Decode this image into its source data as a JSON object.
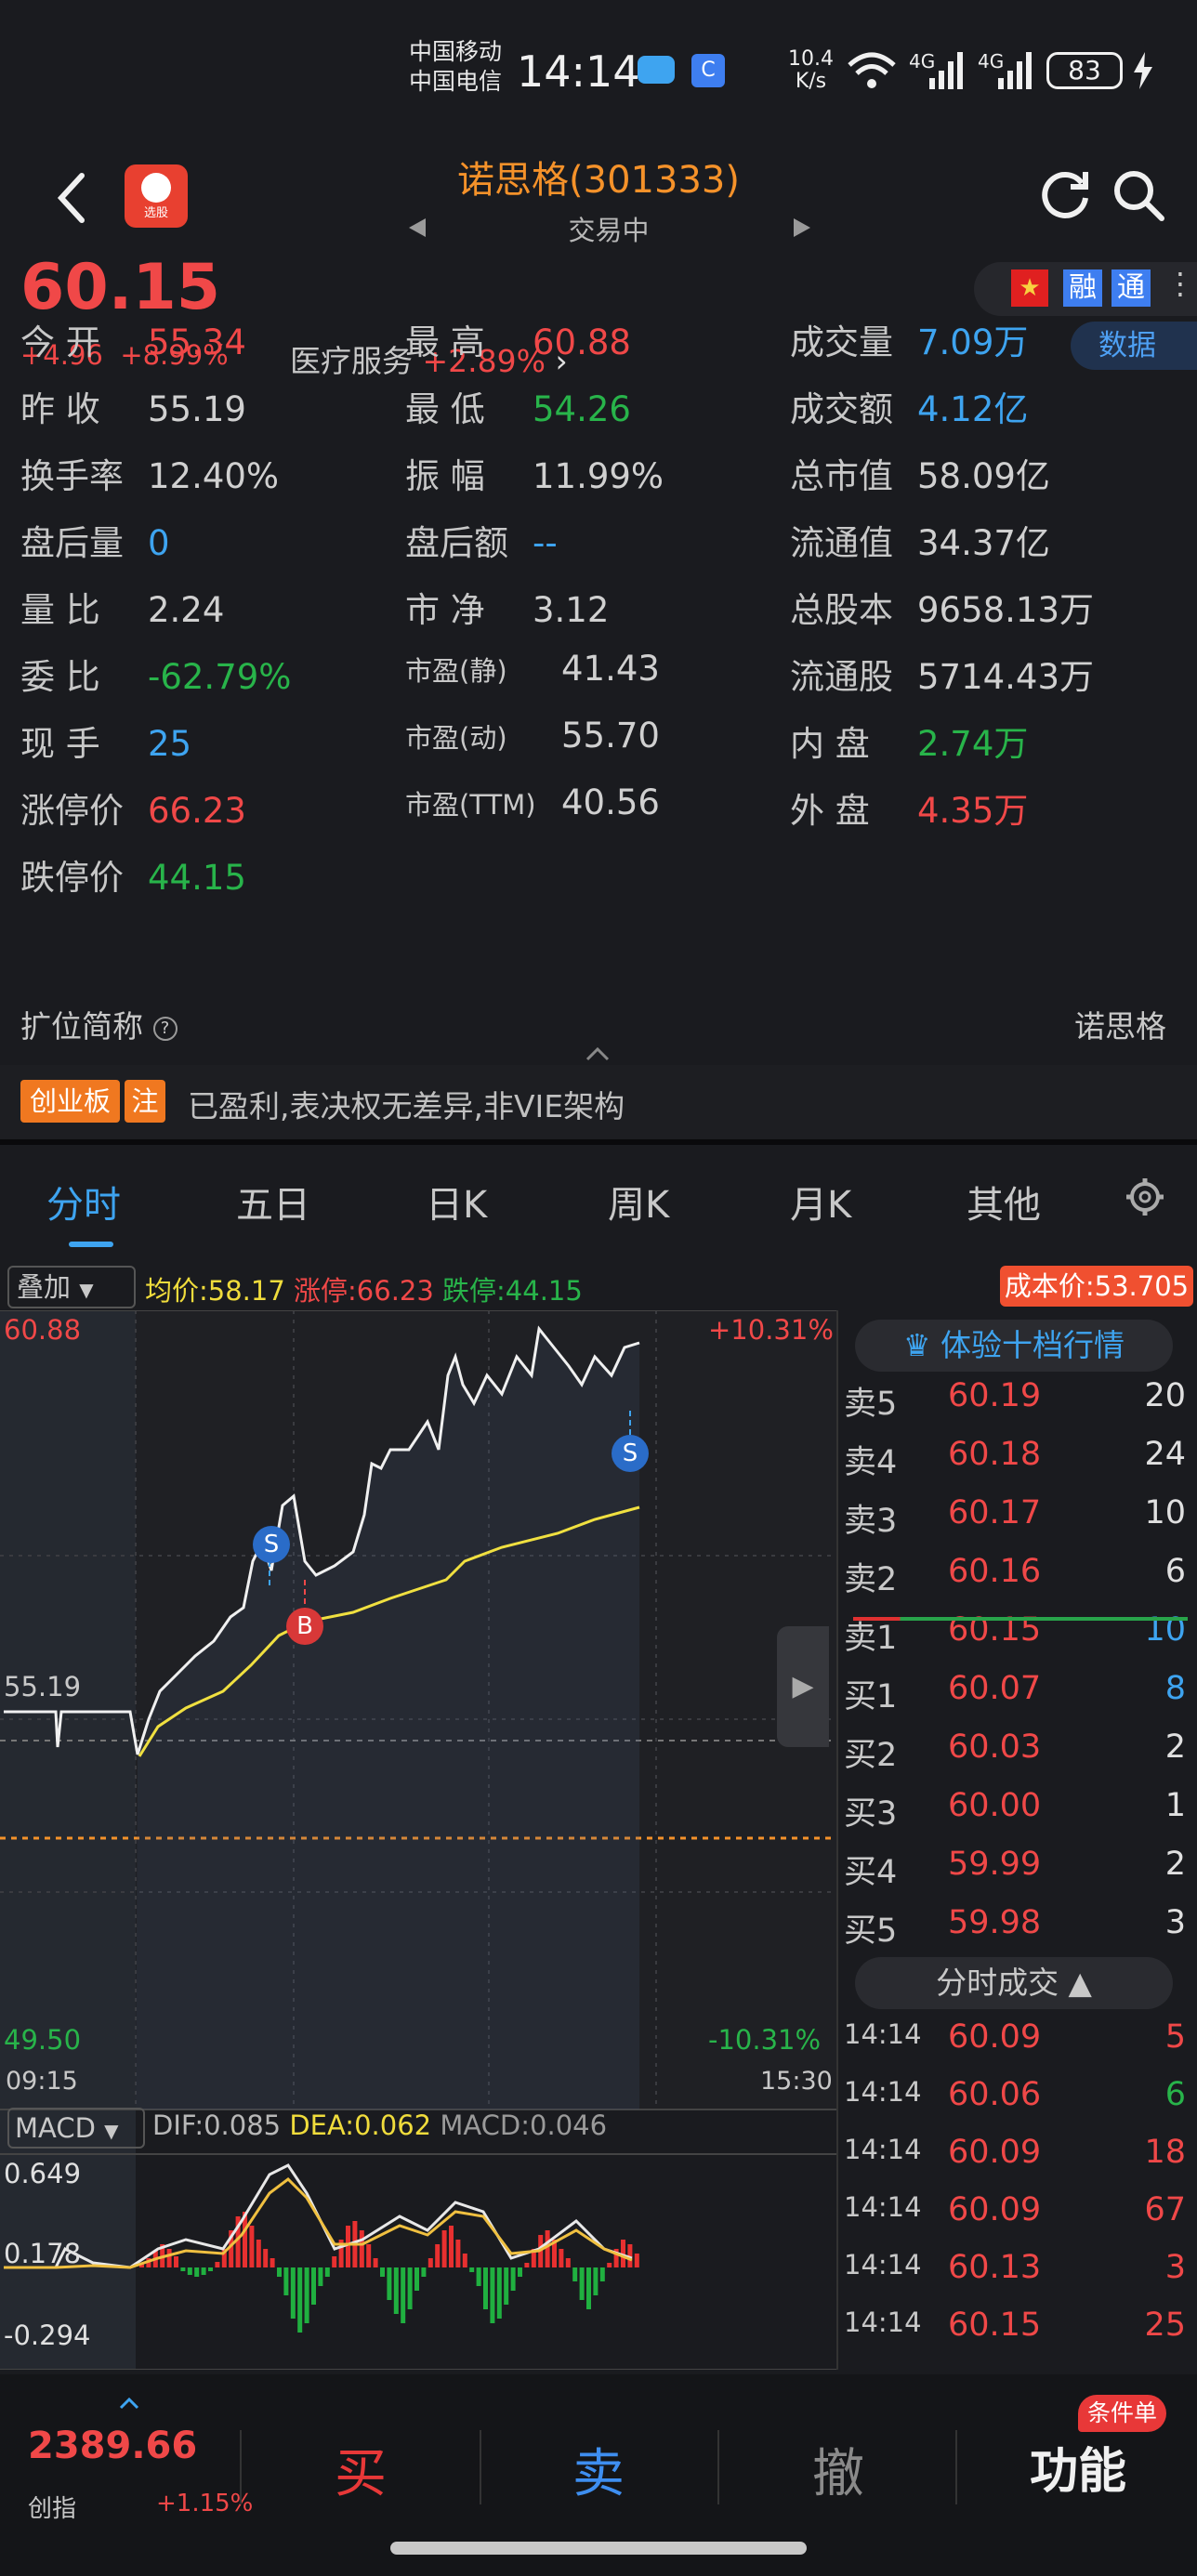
{
  "status_bar": {
    "carrier1": "中国移动",
    "carrier2": "中国电信",
    "time": "14:14",
    "speed_top": "10.4",
    "speed_bottom": "K/s",
    "net1": "4G",
    "net2": "4G",
    "battery": "83"
  },
  "header": {
    "title": "诺思格(301333)",
    "subtitle": "交易中",
    "logo_text": "选股"
  },
  "price": {
    "current": "60.15",
    "change": "+4.96",
    "change_pct": "+8.99%",
    "sector": "医疗服务",
    "sector_pct": "+2.89%",
    "badge_rong": "融",
    "badge_tong": "通",
    "data_btn": "数据"
  },
  "stats": [
    {
      "label": "今 开",
      "value": "55.34",
      "color": "red"
    },
    {
      "label": "最 高",
      "value": "60.88",
      "color": "red"
    },
    {
      "label": "成交量",
      "value": "7.09万",
      "color": "blue"
    },
    {
      "label": "昨 收",
      "value": "55.19",
      "color": "gray"
    },
    {
      "label": "最 低",
      "value": "54.26",
      "color": "green"
    },
    {
      "label": "成交额",
      "value": "4.12亿",
      "color": "blue"
    },
    {
      "label": "换手率",
      "value": "12.40%",
      "color": "gray"
    },
    {
      "label": "振 幅",
      "value": "11.99%",
      "color": "gray"
    },
    {
      "label": "总市值",
      "value": "58.09亿",
      "color": "gray"
    },
    {
      "label": "盘后量",
      "value": "0",
      "color": "blue"
    },
    {
      "label": "盘后额",
      "value": "--",
      "color": "blue"
    },
    {
      "label": "流通值",
      "value": "34.37亿",
      "color": "gray"
    },
    {
      "label": "量 比",
      "value": "2.24",
      "color": "gray"
    },
    {
      "label": "市 净",
      "value": "3.12",
      "color": "gray"
    },
    {
      "label": "总股本",
      "value": "9658.13万",
      "color": "gray"
    },
    {
      "label": "委 比",
      "value": "-62.79%",
      "color": "green"
    },
    {
      "label": "市盈(静)",
      "value": "41.43",
      "color": "gray"
    },
    {
      "label": "流通股",
      "value": "5714.43万",
      "color": "gray"
    },
    {
      "label": "现 手",
      "value": "25",
      "color": "blue"
    },
    {
      "label": "市盈(动)",
      "value": "55.70",
      "color": "gray"
    },
    {
      "label": "内 盘",
      "value": "2.74万",
      "color": "green"
    },
    {
      "label": "涨停价",
      "value": "66.23",
      "color": "red"
    },
    {
      "label": "市盈(TTM)",
      "value": "40.56",
      "color": "gray"
    },
    {
      "label": "外 盘",
      "value": "4.35万",
      "color": "red"
    },
    {
      "label": "跌停价",
      "value": "44.15",
      "color": "green"
    }
  ],
  "extra": {
    "label": "扩位简称",
    "value": "诺思格",
    "tag1": "创业板",
    "tag2": "注",
    "desc": "已盈利,表决权无差异,非VIE架构"
  },
  "tabs": [
    "分时",
    "五日",
    "日K",
    "周K",
    "月K",
    "其他"
  ],
  "chart_bar": {
    "overlay": "叠加",
    "avg": "均价:58.17",
    "limit_up": "涨停:66.23",
    "limit_down": "跌停:44.15",
    "cost": "成本价:53.705"
  },
  "chart_labels": {
    "top_price": "60.88",
    "top_pct": "+10.31%",
    "prev_close": "55.19",
    "bottom_price": "49.50",
    "bottom_pct": "-10.31%",
    "time_start": "09:15",
    "time_end": "15:30",
    "marker_s": "S",
    "marker_b": "B"
  },
  "macd": {
    "label": "MACD",
    "dif": "DIF:0.085",
    "dea": "DEA:0.062",
    "macd": "MACD:0.046",
    "top": "0.649",
    "mid": "0.178",
    "bottom": "-0.294"
  },
  "orderbook": {
    "promo": "体验十档行情",
    "sells": [
      {
        "label": "卖5",
        "price": "60.19",
        "vol": "20"
      },
      {
        "label": "卖4",
        "price": "60.18",
        "vol": "24"
      },
      {
        "label": "卖3",
        "price": "60.17",
        "vol": "10"
      },
      {
        "label": "卖2",
        "price": "60.16",
        "vol": "6"
      },
      {
        "label": "卖1",
        "price": "60.15",
        "vol": "10"
      }
    ],
    "buys": [
      {
        "label": "买1",
        "price": "60.07",
        "vol": "8"
      },
      {
        "label": "买2",
        "price": "60.03",
        "vol": "2"
      },
      {
        "label": "买3",
        "price": "60.00",
        "vol": "1"
      },
      {
        "label": "买4",
        "price": "59.99",
        "vol": "2"
      },
      {
        "label": "买5",
        "price": "59.98",
        "vol": "3"
      }
    ],
    "trades_title": "分时成交",
    "trades": [
      {
        "time": "14:14",
        "price": "60.09",
        "vol": "5"
      },
      {
        "time": "14:14",
        "price": "60.06",
        "vol": "6"
      },
      {
        "time": "14:14",
        "price": "60.09",
        "vol": "18"
      },
      {
        "time": "14:14",
        "price": "60.09",
        "vol": "67"
      },
      {
        "time": "14:14",
        "price": "60.13",
        "vol": "3"
      },
      {
        "time": "14:14",
        "price": "60.15",
        "vol": "25"
      }
    ]
  },
  "bottom": {
    "index_value": "2389.66",
    "index_name": "创指",
    "index_pct": "+1.15%",
    "buy": "买",
    "sell": "卖",
    "cancel": "撤",
    "func": "功能",
    "func_badge": "条件单"
  }
}
